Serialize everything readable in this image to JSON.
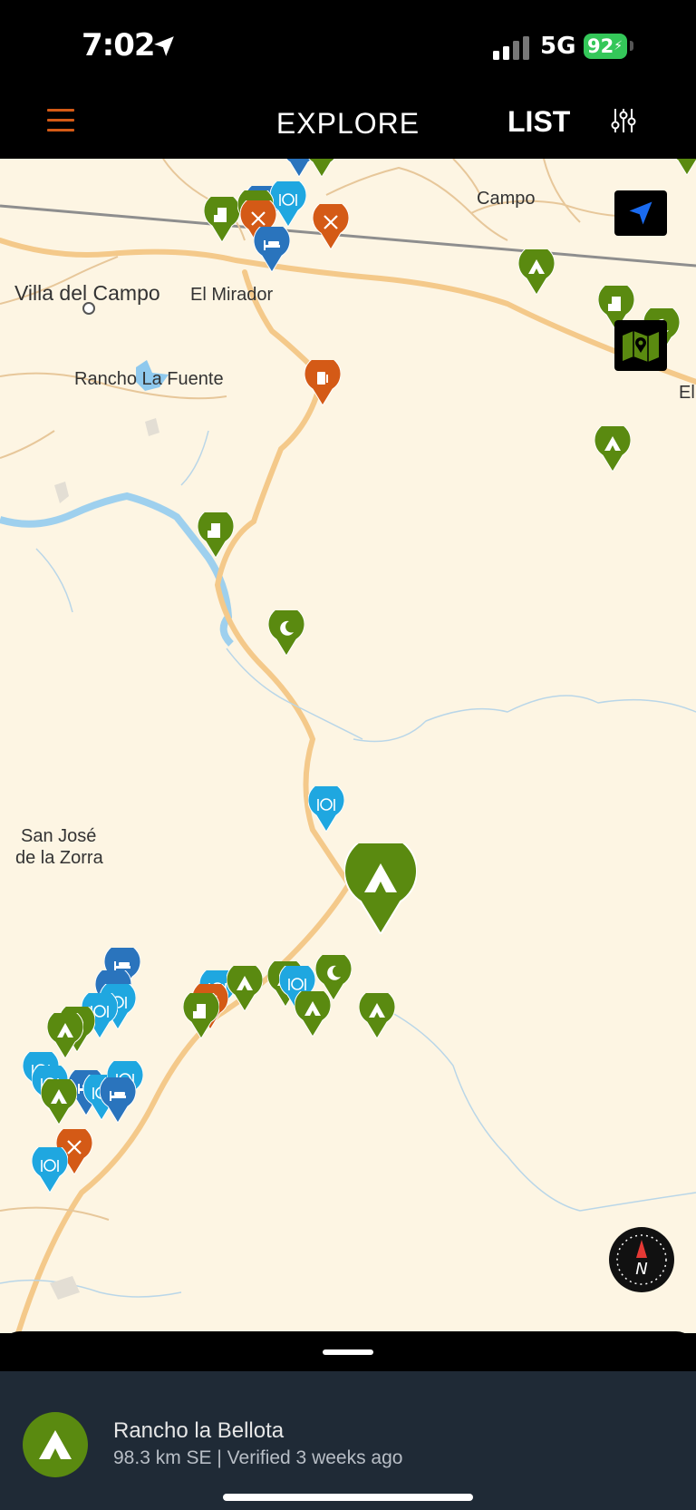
{
  "status_bar": {
    "time": "7:02",
    "network": "5G",
    "battery": "92"
  },
  "nav": {
    "title": "EXPLORE",
    "list_label": "LIST",
    "menu_icon": "hamburger-icon",
    "filter_icon": "sliders-icon"
  },
  "map": {
    "places": {
      "campo": "Campo",
      "villa_del_campo": "Villa del Campo",
      "el_mirador": "El Mirador",
      "rancho_la_fuente": "Rancho La Fuente",
      "el": "El",
      "san_jose_1": "San José",
      "san_jose_2": "de la Zorra"
    },
    "pin_colors": {
      "camp": "#5a8a10",
      "food": "#1fa7e0",
      "lodging": "#2a74bd",
      "service": "#d45a16"
    }
  },
  "selected": {
    "name": "Rancho la Bellota",
    "details": "98.3 km SE | Verified 3 weeks ago"
  }
}
